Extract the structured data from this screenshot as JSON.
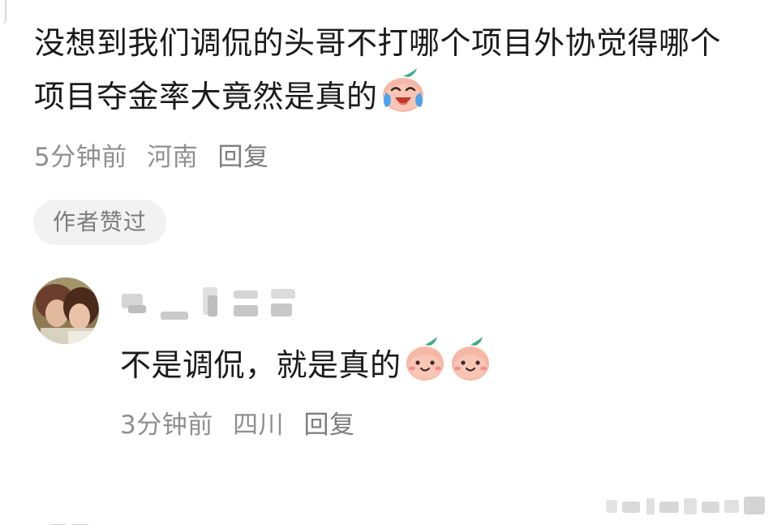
{
  "comment": {
    "text": "没想到我们调侃的头哥不打哪个项目外协觉得哪个项目夺金率大竟然是真的",
    "emoji": "laughing-crying-peach-icon",
    "time": "5分钟前",
    "location": "河南",
    "reply_label": "回复",
    "liked_badge": "作者赞过"
  },
  "reply": {
    "text": "不是调侃，就是真的",
    "emojis": [
      "smiling-peach-icon",
      "smiling-peach-icon"
    ],
    "time": "3分钟前",
    "location": "四川",
    "reply_label": "回复"
  },
  "colors": {
    "meta_text": "#8f8f8f",
    "badge_bg": "#f2f2f2",
    "peach": "#f6b8a6",
    "leaf": "#3fae85"
  }
}
